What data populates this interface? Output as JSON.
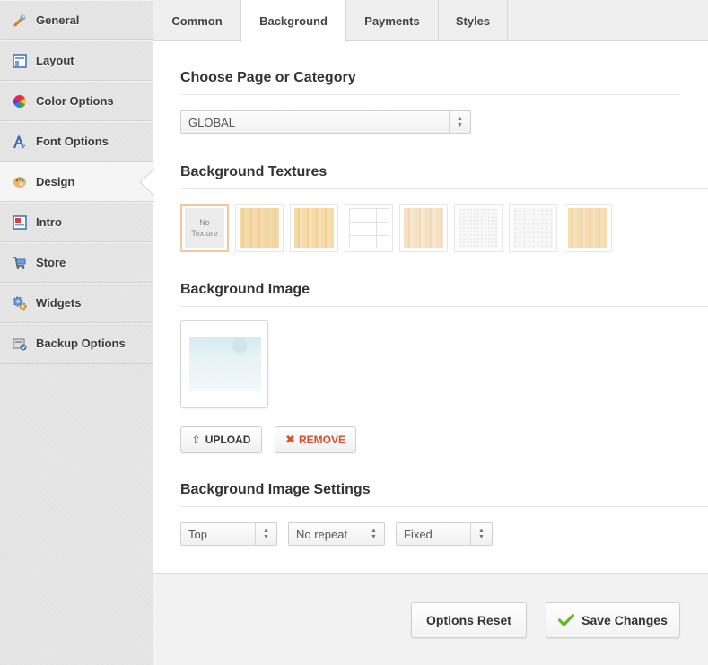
{
  "sidebar": {
    "items": [
      {
        "label": "General",
        "icon": "wrench-icon"
      },
      {
        "label": "Layout",
        "icon": "layout-icon"
      },
      {
        "label": "Color Options",
        "icon": "color-wheel-icon"
      },
      {
        "label": "Font Options",
        "icon": "font-icon"
      },
      {
        "label": "Design",
        "icon": "palette-icon"
      },
      {
        "label": "Intro",
        "icon": "intro-icon"
      },
      {
        "label": "Store",
        "icon": "cart-icon"
      },
      {
        "label": "Widgets",
        "icon": "gears-icon"
      },
      {
        "label": "Backup Options",
        "icon": "backup-icon"
      }
    ],
    "active": "Design"
  },
  "tabs": [
    {
      "label": "Common"
    },
    {
      "label": "Background"
    },
    {
      "label": "Payments"
    },
    {
      "label": "Styles"
    }
  ],
  "active_tab": "Background",
  "page_select": {
    "title": "Choose Page or Category",
    "value": "GLOBAL"
  },
  "textures": {
    "title": "Background Textures",
    "no_texture_label": "No Texture",
    "items": [
      {
        "name": "no-texture",
        "color": "#ececec"
      },
      {
        "name": "wood-light-1",
        "color": "#f3d7a3"
      },
      {
        "name": "wood-light-2",
        "color": "#f5dba8"
      },
      {
        "name": "grid",
        "color": "#ffffff"
      },
      {
        "name": "wood-pale",
        "color": "#f6e0c4"
      },
      {
        "name": "noise-light-1",
        "color": "#f8f8f8"
      },
      {
        "name": "noise-light-2",
        "color": "#f5f5f5"
      },
      {
        "name": "wood-light-3",
        "color": "#f4dbb0"
      }
    ]
  },
  "bg_image": {
    "title": "Background Image",
    "upload_label": "UPLOAD",
    "remove_label": "REMOVE"
  },
  "bg_settings": {
    "title": "Background Image Settings",
    "position": "Top",
    "repeat": "No repeat",
    "attachment": "Fixed"
  },
  "footer": {
    "reset_label": "Options Reset",
    "save_label": "Save Changes"
  },
  "colors": {
    "remove_red": "#e04b2a",
    "upload_green": "#3a9a2a",
    "check_green": "#6ab82a",
    "selected_border": "#f4c89b"
  }
}
